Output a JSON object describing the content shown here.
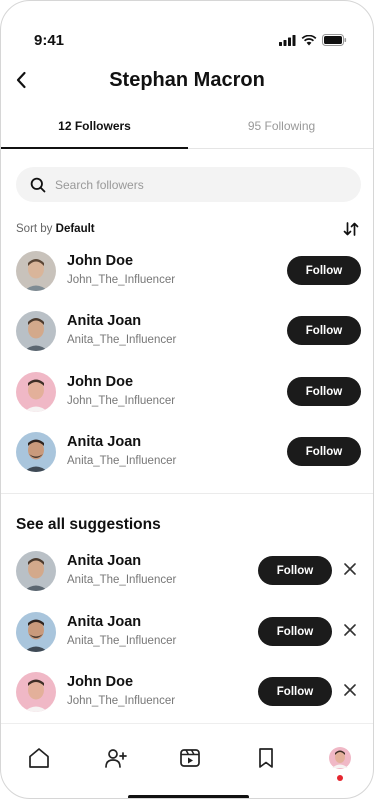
{
  "status": {
    "time": "9:41"
  },
  "header": {
    "title": "Stephan Macron"
  },
  "tabs": [
    {
      "label": "12 Followers",
      "active": true
    },
    {
      "label": "95 Following",
      "active": false
    }
  ],
  "search": {
    "placeholder": "Search followers"
  },
  "sort": {
    "prefix": "Sort by",
    "value": "Default"
  },
  "followers": [
    {
      "name": "John Doe",
      "handle": "John_The_Influencer",
      "button": "Follow",
      "avatar_color": "#c8c2bb"
    },
    {
      "name": "Anita Joan",
      "handle": "Anita_The_Influencer",
      "button": "Follow",
      "avatar_color": "#b9c0c6"
    },
    {
      "name": "John Doe",
      "handle": "John_The_Influencer",
      "button": "Follow",
      "avatar_color": "#f0b8c6"
    },
    {
      "name": "Anita Joan",
      "handle": "Anita_The_Influencer",
      "button": "Follow",
      "avatar_color": "#a9c5dc"
    }
  ],
  "suggestions": {
    "title": "See all suggestions",
    "items": [
      {
        "name": "Anita Joan",
        "handle": "Anita_The_Influencer",
        "button": "Follow",
        "avatar_color": "#b9c0c6"
      },
      {
        "name": "Anita Joan",
        "handle": "Anita_The_Influencer",
        "button": "Follow",
        "avatar_color": "#a9c5dc"
      },
      {
        "name": "John Doe",
        "handle": "John_The_Influencer",
        "button": "Follow",
        "avatar_color": "#f0b8c6"
      }
    ]
  },
  "bottom_nav": {
    "items": [
      "home-icon",
      "add-user-icon",
      "reels-icon",
      "bookmark-icon",
      "profile-avatar"
    ],
    "notification_color": "#e5262f"
  },
  "colors": {
    "primary": "#1b1b1b",
    "muted": "#999999",
    "search_bg": "#f3f3f3"
  }
}
